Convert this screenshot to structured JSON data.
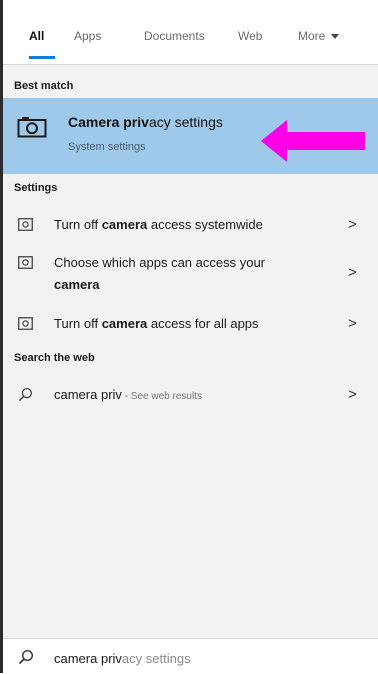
{
  "tabs": [
    {
      "label": "All"
    },
    {
      "label": "Apps"
    },
    {
      "label": "Documents"
    },
    {
      "label": "Web"
    },
    {
      "label": "More"
    }
  ],
  "sections": {
    "best_match": "Best match",
    "settings": "Settings",
    "search_web": "Search the web"
  },
  "best_match": {
    "title_bold": "Camera priv",
    "title_rest": "acy settings",
    "subtitle": "System settings",
    "icon": "camera-icon",
    "arrow_color": "#ff00e6"
  },
  "settings_items": [
    {
      "pre": "Turn off ",
      "bold": "camera",
      "post": " access systemwide",
      "icon": "settings-camera-icon"
    },
    {
      "pre": "Choose which apps can access your",
      "bold": "camera",
      "post": "",
      "icon": "settings-camera-icon"
    },
    {
      "pre": "Turn off ",
      "bold": "camera",
      "post": " access for all apps",
      "icon": "settings-camera-icon"
    }
  ],
  "web_item": {
    "query": "camera priv",
    "suffix": " - See web results",
    "icon": "search-icon"
  },
  "chevron": ">",
  "search": {
    "typed": "camera priv",
    "suggestion": "acy settings",
    "icon": "search-icon"
  },
  "colors": {
    "highlight": "#9ec9ea",
    "accent": "#0a7ed7",
    "arrow": "#ff00e6"
  }
}
